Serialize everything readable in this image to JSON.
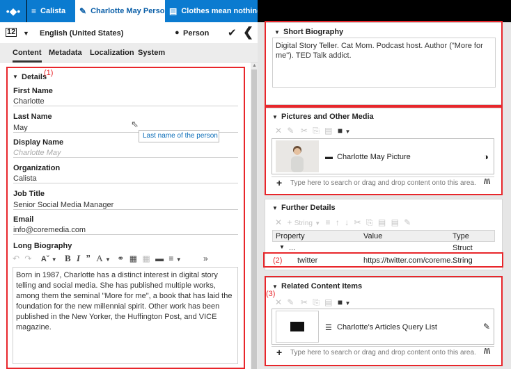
{
  "tabs": {
    "home_icon": "workspace-icon",
    "calista": "Calista",
    "charlotte": "Charlotte May Person",
    "clothes": "Clothes mean nothing u..."
  },
  "toolbar": {
    "lang_label": "English (United States)",
    "doctype_label": "Person"
  },
  "nav": {
    "content": "Content",
    "metadata": "Metadata",
    "localization": "Localization",
    "system": "System"
  },
  "details": {
    "title": "Details",
    "annot": "(1)",
    "fields": [
      {
        "label": "First Name",
        "value": "Charlotte"
      },
      {
        "label": "Last Name",
        "value": "May"
      },
      {
        "label": "Display Name",
        "value": "Charlotte May"
      },
      {
        "label": "Organization",
        "value": "Calista"
      },
      {
        "label": "Job Title",
        "value": "Senior Social Media Manager"
      },
      {
        "label": "Email",
        "value": "info@coremedia.com"
      }
    ],
    "long_bio_label": "Long Biography",
    "long_bio_text": "Born in 1987, Charlotte has a distinct interest in digital story telling and social media. She has published multiple works, among them the seminal \"More for me\", a book that has laid the foundation for the new millennial spirit. Other work has been published in the New Yorker, the Huffington Post, and VICE magazine."
  },
  "tooltip": "Last name of the person",
  "short_bio": {
    "title": "Short Biography",
    "text": "Digital Story Teller. Cat Mom. Podcast host. Author (\"More for me\"). TED Talk addict."
  },
  "pictures": {
    "title": "Pictures and Other Media",
    "item_label": "Charlotte May Picture",
    "placeholder": "Type here to search or drag and drop content onto this area."
  },
  "further": {
    "title": "Further Details",
    "string_label": "String",
    "columns": [
      "Property",
      "Value",
      "Type"
    ],
    "rows": [
      {
        "property": "...",
        "value": "",
        "type": "Struct"
      },
      {
        "property": "twitter",
        "value": "https://twitter.com/coreme...",
        "type": "String"
      }
    ],
    "annot": "(2)"
  },
  "related": {
    "title": "Related Content Items",
    "annot": "(3)",
    "item_label": "Charlotte's Articles Query List",
    "placeholder": "Type here to search or drag and drop content onto this area."
  },
  "colors": {
    "accent": "#0b7bd0",
    "annotation": "#e8262b"
  }
}
